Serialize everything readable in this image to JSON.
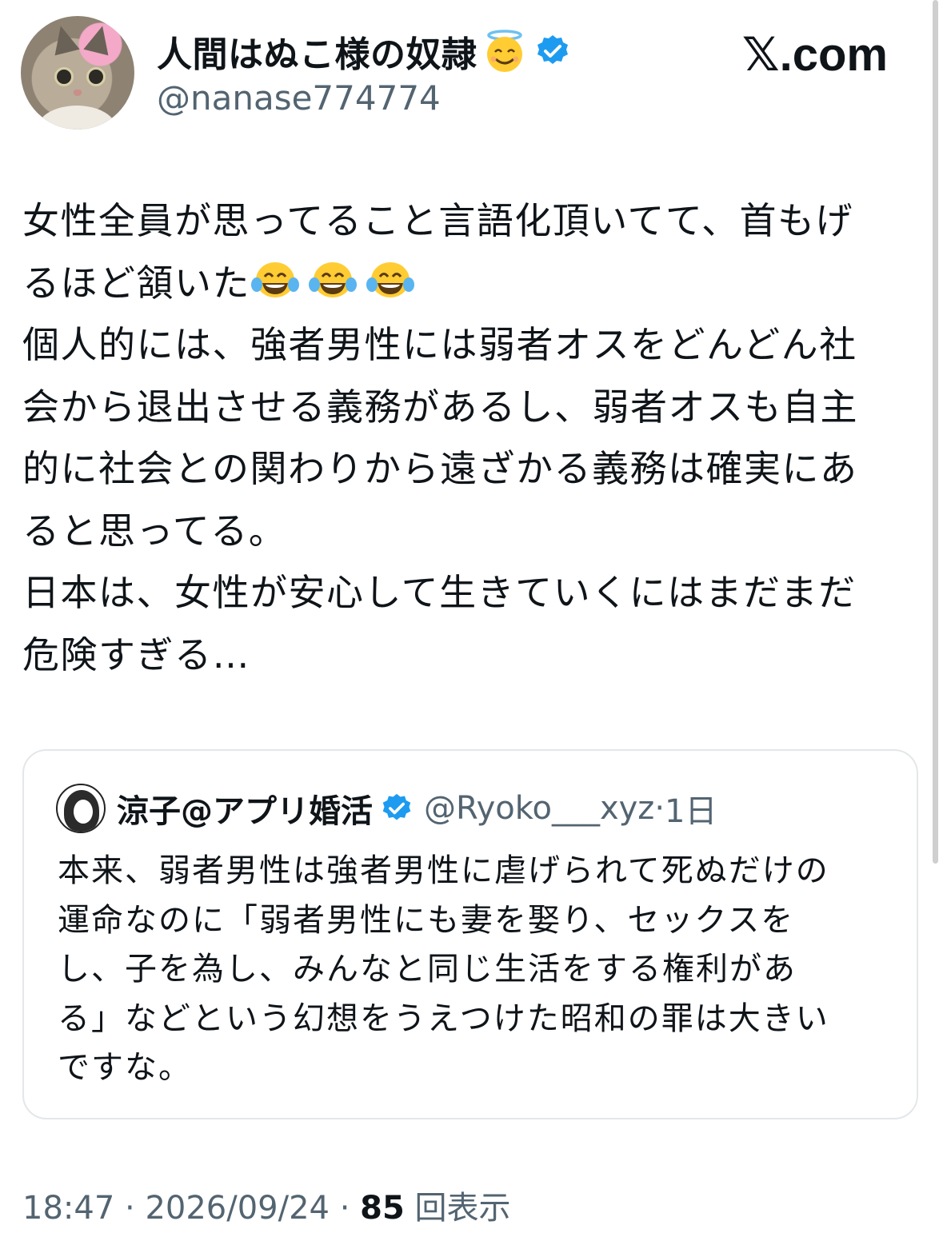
{
  "author": {
    "display_name": "人間はぬこ様の奴隷",
    "handle": "@nanase774774",
    "verified": true,
    "halo_emoji": "smiling-face-with-halo"
  },
  "brand": "𝕏.com",
  "tweet": {
    "text_lines": [
      "女性全員が思ってること言語化頂いてて、首もげ",
      "るほど頷いた",
      "個人的には、強者男性には弱者オスをどんどん社",
      "会から退出させる義務があるし、弱者オスも自主",
      "的に社会との関わりから遠ざかる義務は確実にあ",
      "ると思ってる。",
      "日本は、女性が安心して生きていくにはまだまだ",
      "危険すぎる…"
    ],
    "emojis": [
      "face-with-tears-of-joy",
      "face-with-tears-of-joy",
      "face-with-tears-of-joy"
    ]
  },
  "quote": {
    "display_name": "涼子@アプリ婚活",
    "handle": "@Ryoko___xyz",
    "age": "1日",
    "verified": true,
    "text_lines": [
      "本来、弱者男性は強者男性に虐げられて死ぬだけの",
      "運命なのに「弱者男性にも妻を娶り、セックスを",
      "し、子を為し、みんなと同じ生活をする権利があ",
      "る」などという幻想をうえつけた昭和の罪は大きい",
      "ですな。"
    ]
  },
  "footer": {
    "time": "18:47",
    "date": "2026/09/24",
    "views_count": "85",
    "views_label": "回表示"
  },
  "colors": {
    "text": "#0f1419",
    "muted": "#536471",
    "verified": "#1d9bf0",
    "border": "#e3e7ea"
  }
}
